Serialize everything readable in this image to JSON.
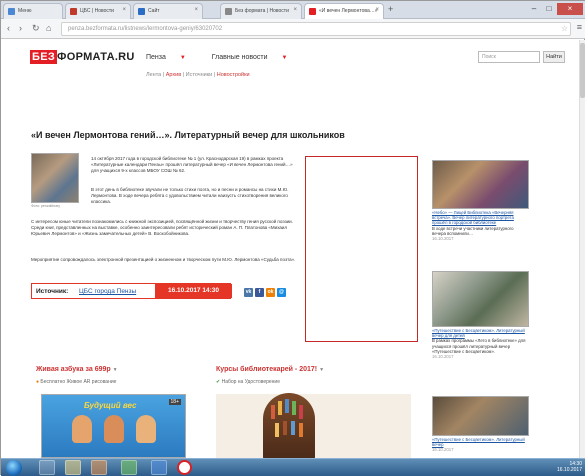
{
  "browser": {
    "tabs": [
      {
        "label": "Меню",
        "favicon_color": "#4a88d6"
      },
      {
        "label": "ЦБС | Новости",
        "favicon_color": "#c0392b"
      },
      {
        "label": "Сайт",
        "favicon_color": "#2b6cc4"
      },
      {
        "label": "Без формата | Новости",
        "favicon_color": "#888888"
      },
      {
        "label": "«И вечен Лермонтова…»",
        "favicon_color": "#e31e24"
      }
    ],
    "address": "penza.bezformata.ru/listnews/lermontova-geniy/63020702",
    "icons": [
      "back-icon",
      "forward-icon",
      "reload-icon",
      "home-icon",
      "star-icon",
      "menu-icon"
    ]
  },
  "site": {
    "logo_red": "БЕЗ",
    "logo_rest": "ФОРМАТА.RU",
    "nav": [
      {
        "label": "Пенза"
      },
      {
        "label": "Главные новости"
      }
    ],
    "subnav": [
      {
        "label": "Лента"
      },
      {
        "label": "Архив"
      },
      {
        "label": "Источники"
      },
      {
        "label": "Новостройки"
      }
    ],
    "search_placeholder": "Поиск",
    "search_button": "Найти"
  },
  "article": {
    "title": "«И вечен Лермонтова гений…». Литературный вечер для школьников",
    "photo_caption": "Фото: penzalibrary",
    "para1": "14 октября 2017 года в городской библиотеке № 1 (ул. Краснодарская 19) в рамках проекта «Литературные календари Пензы» прошёл литературный вечер «И вечен Лермонтова гений…» для учащихся 9-х классов МБОУ СОШ № 62.",
    "para2": "В этот день в библиотеке звучали не только стихи поэта, но и песни и романсы на стихи М.Ю. Лермонтова. В ходе вечера ребята с удовольствием читали наизусть стихотворения великого классика.",
    "para3": "С интересом юные читатели познакомились с книжной экспозицией, посвящённой жизни и творчеству гения русской поэзии. Среди книг, представленных на выставке, особенно заинтересовали ребят исторический роман А. П. Платонова «Михаил Юрьевич Лермонтов» и «Жизнь замечательных детей» В. Воскобойникова.",
    "para4": "Мероприятие сопровождалось электронной презентацией о жизненном и творческом пути М.Ю. Лермонтова «Судьба поэта».",
    "source_label": "Источник:",
    "source_link": "ЦБС города Пензы",
    "source_date": "16.10.2017  14:30",
    "share": [
      {
        "name": "vk",
        "label": "vk",
        "color": "#4a76a8"
      },
      {
        "name": "facebook",
        "label": "f",
        "color": "#3b5998"
      },
      {
        "name": "odnoklassniki",
        "label": "ok",
        "color": "#ee8208"
      },
      {
        "name": "mailru",
        "label": "@",
        "color": "#168de2"
      }
    ]
  },
  "sidebar": {
    "items": [
      {
        "caption_link": "«Небо» — Лицей Библиотека «Вечерняя встреча». Вечер литературного портрета прошёл в городской библиотеке",
        "caption_text": "В ходе встречи участники литературного вечера вспомнили…",
        "date": "16.10.2017"
      },
      {
        "caption_link": "«Путешествие с Бесцветиком». Литературный вечер для детей",
        "caption_text": "В рамках программы «Лето в библиотеке» для учащихся прошёл литературный вечер «Путешествие с Бесцветиком».",
        "date": "16.10.2017"
      },
      {
        "caption_link": "«Путешествие с Бесцветиком». Литературный вечер",
        "caption_text": "",
        "date": "16.10.2017"
      }
    ]
  },
  "recommend": [
    {
      "title": "Живая азбука за 699р",
      "sub": "Бесплатно Живое АR рисование"
    },
    {
      "title": "Курсы библиотекарей - 2017!",
      "sub": "Набор на Удостоверение"
    }
  ],
  "photo_badge": "18+",
  "card_title": "Будущий вес",
  "taskbar": {
    "time": "14:30",
    "date": "16.10.2017",
    "apps": [
      "explorer-icon",
      "folder-icon",
      "media-icon",
      "chrome-icon",
      "word-icon",
      "opera-icon"
    ]
  }
}
